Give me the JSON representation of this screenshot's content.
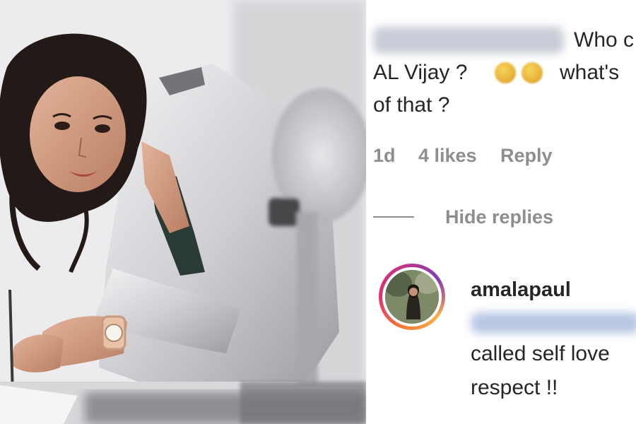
{
  "photo": {
    "alt": "",
    "background_color": "#e5e5e8"
  },
  "comment": {
    "line1_visible": "Who c",
    "line2_name": "AL Vijay ?",
    "line2_tail": "what's",
    "line3": "of that ?",
    "emoji_icon": "face-emoji-icon",
    "meta": {
      "age": "1d",
      "likes": "4 likes",
      "reply_label": "Reply"
    }
  },
  "replies_toggle": {
    "label": "Hide replies"
  },
  "reply": {
    "username": "amalapaul",
    "text_line1": "called self love",
    "text_line2": "respect !!",
    "ring_colors": [
      "#f77737",
      "#e1306c",
      "#c13584",
      "#833ab4",
      "#fcaf45"
    ]
  },
  "colors": {
    "text": "#262626",
    "secondary": "#8e8e8e"
  }
}
